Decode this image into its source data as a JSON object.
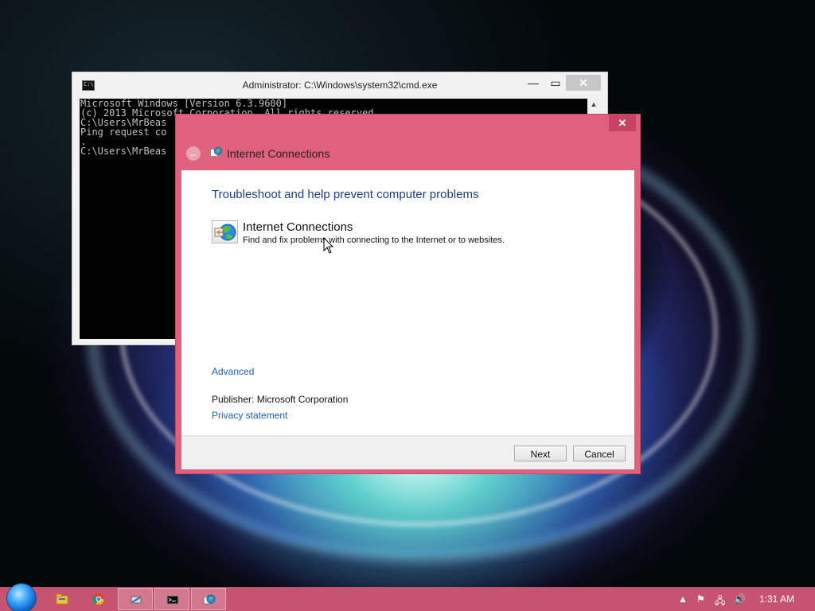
{
  "cmd": {
    "title": "Administrator: C:\\Windows\\system32\\cmd.exe",
    "buttons": {
      "minimize": "—",
      "maximize": "▭",
      "close": "✕"
    },
    "lines": [
      "Microsoft Windows [Version 6.3.9600]",
      "(c) 2013 Microsoft Corporation. All rights reserved.",
      "",
      "C:\\Users\\MrBeas",
      "Ping request co",
      ".",
      "",
      "C:\\Users\\MrBeas"
    ]
  },
  "dialog": {
    "close": "✕",
    "back": "←",
    "header_title": "Internet Connections",
    "heading": "Troubleshoot and help prevent computer problems",
    "tool_name": "Internet Connections",
    "tool_desc": "Find and fix problems with connecting to the Internet or to websites.",
    "advanced": "Advanced",
    "publisher": "Publisher:  Microsoft Corporation",
    "privacy": "Privacy statement",
    "next": "Next",
    "cancel": "Cancel"
  },
  "taskbar": {
    "items": [
      {
        "name": "file-explorer",
        "icon": "folder-icon"
      },
      {
        "name": "chrome",
        "icon": "chrome-icon"
      },
      {
        "name": "network-tool",
        "icon": "network-icon"
      },
      {
        "name": "cmd",
        "icon": "cmd-icon"
      },
      {
        "name": "troubleshooter",
        "icon": "troubleshooter-icon"
      }
    ],
    "tray": {
      "arrow": "▲",
      "flag": "⚑",
      "network": "🖧",
      "volume": "🔊"
    },
    "clock": "1:31 AM"
  },
  "colors": {
    "accent": "#e0617e",
    "taskbar": "#c65470",
    "link": "#1a5fb4",
    "heading": "#1e3f7f"
  }
}
